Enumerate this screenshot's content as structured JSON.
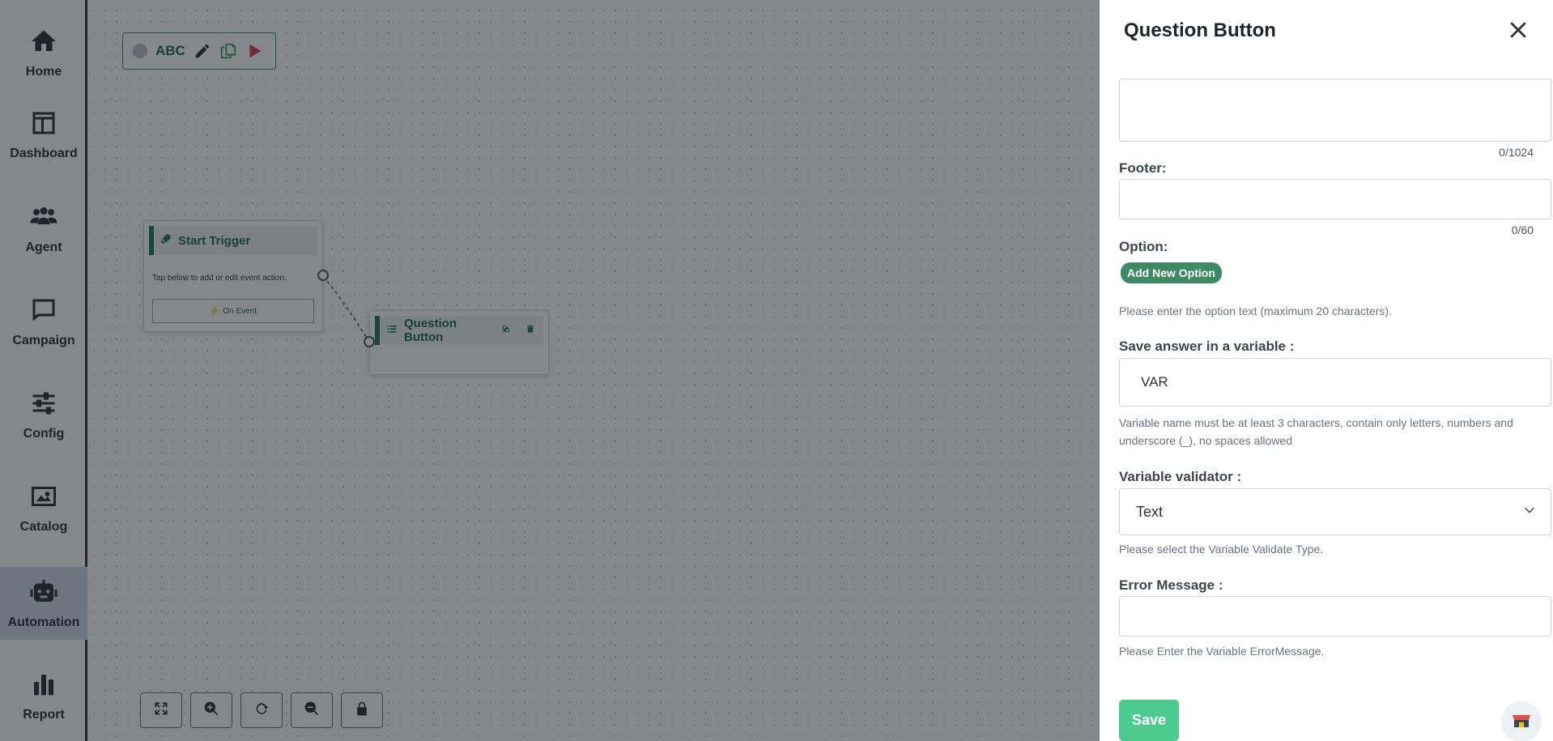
{
  "nav": {
    "items": [
      {
        "label": "Home",
        "icon": "home-icon"
      },
      {
        "label": "Dashboard",
        "icon": "layout-icon"
      },
      {
        "label": "Agent",
        "icon": "users-icon"
      },
      {
        "label": "Campaign",
        "icon": "chat-icon"
      },
      {
        "label": "Config",
        "icon": "sliders-icon"
      },
      {
        "label": "Catalog",
        "icon": "image-icon"
      },
      {
        "label": "Automation",
        "icon": "robot-icon"
      },
      {
        "label": "Report",
        "icon": "bar-chart-icon"
      }
    ],
    "active": "Automation"
  },
  "flow_toolbar": {
    "name": "ABC"
  },
  "nodes": {
    "start": {
      "title": "Start Trigger",
      "text": "Tap below to add or edit event action.",
      "button": "On Event"
    },
    "question": {
      "title": "Question Button"
    }
  },
  "drawer": {
    "title": "Question Button",
    "body_counter": "0/1024",
    "footer_label": "Footer:",
    "footer_counter": "0/60",
    "option_label": "Option:",
    "add_option": "Add New Option",
    "option_hint": "Please enter the option text (maximum 20 characters).",
    "variable_label": "Save answer in a variable :",
    "variable_value": "VAR",
    "variable_hint": "Variable name must be at least 3 characters, contain only letters, numbers and underscore (_), no spaces allowed",
    "validator_label": "Variable validator :",
    "validator_value": "Text",
    "validator_hint": "Please select the Variable Validate Type.",
    "error_label": "Error Message :",
    "error_hint": "Please Enter the Variable ErrorMessage.",
    "save": "Save"
  },
  "colors": {
    "accent_green": "#3d8a64",
    "save_green": "#4ccb8f",
    "node_green": "#1f7a57"
  }
}
